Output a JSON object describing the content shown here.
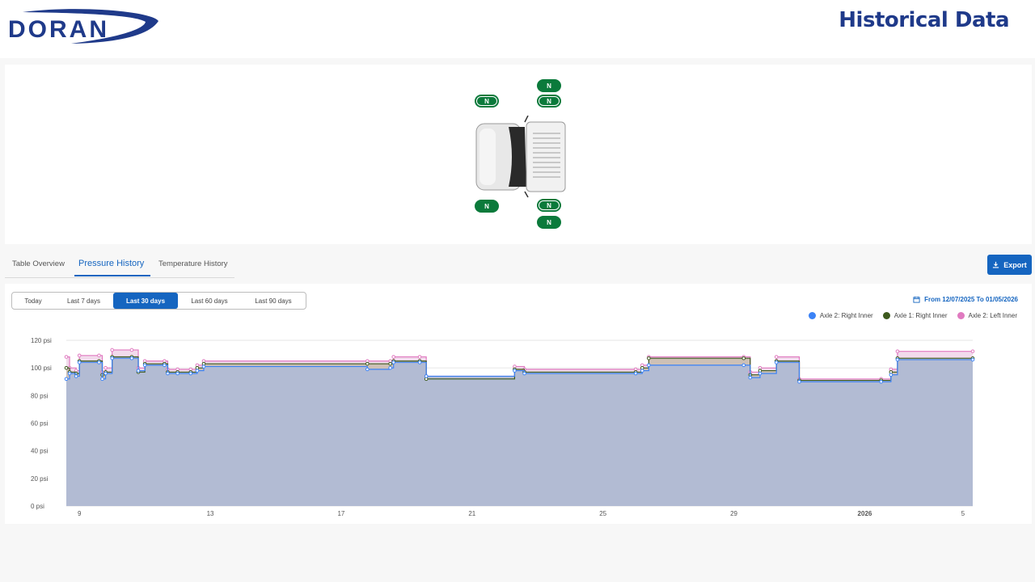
{
  "brand": {
    "logo_text": "DORAN"
  },
  "header": {
    "title": "Historical Data"
  },
  "vehicle": {
    "tires": [
      {
        "id": "axle2-left-outer",
        "label": "N"
      },
      {
        "id": "axle2-left-inner",
        "label": "N"
      },
      {
        "id": "axle1-left",
        "label": "N"
      },
      {
        "id": "axle1-right",
        "label": "N"
      },
      {
        "id": "axle2-right-inner",
        "label": "N"
      },
      {
        "id": "axle2-right-outer",
        "label": "N"
      }
    ],
    "status_color": "#0b7a3b"
  },
  "tabs": {
    "items": [
      {
        "label": "Table Overview"
      },
      {
        "label": "Pressure History"
      },
      {
        "label": "Temperature History"
      }
    ],
    "active": "Pressure History"
  },
  "export": {
    "label": "Export"
  },
  "range_selector": {
    "options": [
      "Today",
      "Last 7 days",
      "Last 30 days",
      "Last 60 days",
      "Last 90 days"
    ],
    "selected": "Last 30 days"
  },
  "date_range": {
    "text": "From 12/07/2025 To 01/05/2026"
  },
  "colors": {
    "accent": "#1565c0",
    "area_fill": "#b2bbd3",
    "blue": "#3b82f6",
    "green": "#3d5a1e",
    "pink": "#e07ac0"
  },
  "chart_data": {
    "type": "area",
    "y_unit": "psi",
    "ylim": [
      0,
      120
    ],
    "y_ticks": [
      0,
      20,
      40,
      60,
      80,
      100,
      120
    ],
    "y_tick_labels": [
      "0 psi",
      "20 psi",
      "40 psi",
      "60 psi",
      "80 psi",
      "100 psi",
      "120 psi"
    ],
    "xlim": [
      8.6,
      36.3
    ],
    "x_ticks": [
      9,
      13,
      17,
      21,
      25,
      29,
      33,
      36
    ],
    "x_tick_labels": [
      "9",
      "13",
      "17",
      "21",
      "25",
      "29",
      "2026",
      "5"
    ],
    "grid": true,
    "legend_position": "top-right",
    "series": [
      {
        "name": "Axle 2: Right Inner",
        "color": "#3b82f6",
        "x": [
          8.6,
          8.7,
          8.9,
          9.0,
          9.6,
          9.7,
          9.8,
          10.0,
          10.6,
          10.8,
          11.0,
          11.6,
          11.7,
          12.0,
          12.4,
          12.6,
          12.8,
          17.8,
          18.5,
          18.6,
          19.4,
          19.6,
          22.3,
          22.6,
          26.0,
          26.2,
          26.4,
          29.3,
          29.5,
          29.8,
          30.3,
          31.0,
          33.5,
          33.8,
          34.0,
          36.3
        ],
        "values": [
          92,
          96,
          94,
          104,
          104,
          92,
          96,
          107,
          107,
          98,
          102,
          102,
          96,
          96,
          96,
          98,
          101,
          99,
          100,
          104,
          104,
          94,
          98,
          96,
          96,
          98,
          102,
          102,
          93,
          96,
          104,
          90,
          90,
          95,
          106,
          106
        ]
      },
      {
        "name": "Axle 1: Right Inner",
        "color": "#3d5a1e",
        "x": [
          8.6,
          8.7,
          8.9,
          9.0,
          9.6,
          9.7,
          9.8,
          10.0,
          10.6,
          10.8,
          11.0,
          11.6,
          11.7,
          12.0,
          12.4,
          12.6,
          12.8,
          17.8,
          18.5,
          18.6,
          19.4,
          19.6,
          22.3,
          22.6,
          26.0,
          26.2,
          26.4,
          29.3,
          29.5,
          29.8,
          30.3,
          31.0,
          33.5,
          33.8,
          34.0,
          36.3
        ],
        "values": [
          100,
          97,
          96,
          105,
          105,
          95,
          97,
          108,
          108,
          97,
          103,
          103,
          97,
          97,
          97,
          100,
          103,
          103,
          103,
          105,
          105,
          92,
          99,
          97,
          97,
          100,
          107,
          107,
          95,
          98,
          105,
          91,
          91,
          97,
          107,
          107
        ]
      },
      {
        "name": "Axle 2: Left Inner",
        "color": "#e07ac0",
        "x": [
          8.6,
          8.7,
          8.9,
          9.0,
          9.6,
          9.7,
          9.8,
          10.0,
          10.6,
          10.8,
          11.0,
          11.6,
          11.7,
          12.0,
          12.4,
          12.6,
          12.8,
          17.8,
          18.5,
          18.6,
          19.4,
          19.6,
          22.3,
          22.6,
          26.0,
          26.2,
          26.4,
          29.3,
          29.5,
          29.8,
          30.3,
          31.0,
          33.5,
          33.8,
          34.0,
          36.3
        ],
        "values": [
          108,
          100,
          98,
          109,
          109,
          97,
          100,
          113,
          113,
          100,
          105,
          105,
          99,
          99,
          99,
          102,
          105,
          105,
          105,
          108,
          108,
          94,
          101,
          99,
          99,
          102,
          108,
          108,
          97,
          100,
          108,
          92,
          92,
          99,
          112,
          112
        ]
      }
    ]
  }
}
